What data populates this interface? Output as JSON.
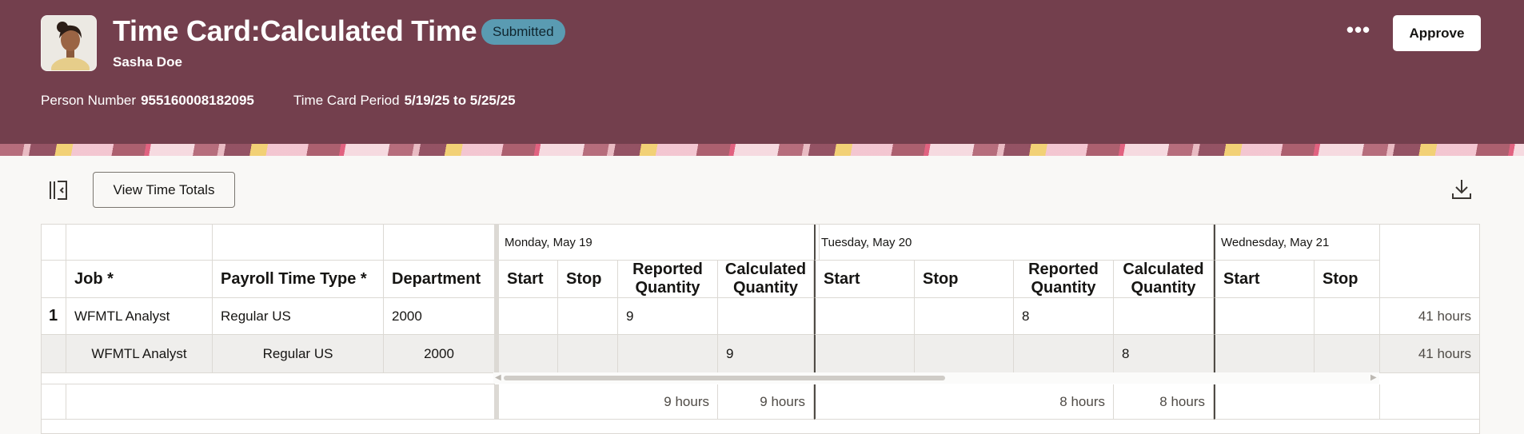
{
  "header": {
    "title": "Time Card:Calculated Time",
    "status": "Submitted",
    "person_name": "Sasha Doe",
    "person_number_label": "Person Number",
    "person_number": "955160008182095",
    "period_label": "Time Card Period",
    "period": "5/19/25 to 5/25/25",
    "more_label": "•••",
    "approve_label": "Approve"
  },
  "toolbar": {
    "view_totals_label": "View Time Totals"
  },
  "grid": {
    "days": [
      "Monday, May 19",
      "Tuesday, May 20",
      "Wednesday, May 21"
    ],
    "columns": {
      "job": "Job *",
      "payroll": "Payroll Time Type *",
      "department": "Department",
      "start": "Start",
      "stop": "Stop",
      "reported_1": "Reported",
      "reported_2": "Quantity",
      "calculated_1": "Calculated",
      "calculated_2": "Quantity"
    },
    "rows": [
      {
        "index": "1",
        "job": "WFMTL Analyst",
        "payroll": "Regular US",
        "department": "2000",
        "mon_reported": "9",
        "mon_calculated": "",
        "tue_reported": "8",
        "tue_calculated": "",
        "total": "41 hours"
      },
      {
        "index": "",
        "job": "WFMTL Analyst",
        "payroll": "Regular US",
        "department": "2000",
        "mon_reported": "",
        "mon_calculated": "9",
        "tue_reported": "",
        "tue_calculated": "8",
        "total": "41 hours"
      }
    ],
    "totals": {
      "mon_reported": "9 hours",
      "mon_calculated": "9 hours",
      "tue_reported": "8 hours",
      "tue_calculated": "8 hours"
    }
  },
  "colors": {
    "header_bg": "#733f4d",
    "badge_bg": "#5a9bb2",
    "page_bg": "#f9f8f6"
  }
}
